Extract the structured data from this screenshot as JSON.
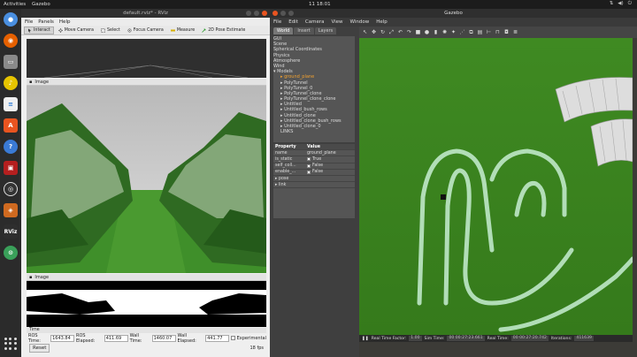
{
  "topbar": {
    "activities": "Activities",
    "app_name": "Gazebo",
    "clock": "11 18:01",
    "tray_icons": [
      "network-icon",
      "volume-icon",
      "power-icon"
    ]
  },
  "dock": {
    "icons": [
      "chromium-icon",
      "firefox-icon",
      "files-icon",
      "rhythmbox-icon",
      "writer-icon",
      "software-icon",
      "help-icon",
      "terminal-icon",
      "obs-icon",
      "rviz-cube-icon",
      "rviz-icon",
      "greenapp-icon",
      "apps-grid-icon"
    ],
    "rviz_label": "RViz"
  },
  "rviz": {
    "title": "default.rviz* - RViz",
    "menu": [
      "File",
      "Panels",
      "Help"
    ],
    "tools": [
      "Interact",
      "Move Camera",
      "Select",
      "Focus Camera",
      "Measure",
      "2D Pose Estimate"
    ],
    "image_panel_1": "Image",
    "image_panel_2": "Image",
    "time_panel": "Time",
    "time": {
      "ros_time_label": "ROS Time:",
      "ros_time": "1643.84",
      "ros_elapsed_label": "ROS Elapsed:",
      "ros_elapsed": "411.69",
      "wall_time_label": "Wall Time:",
      "wall_time": "1460.07",
      "wall_elapsed_label": "Wall Elapsed:",
      "wall_elapsed": "441.77",
      "experimental_label": "Experimental"
    },
    "reset_label": "Reset",
    "fps": "18 fps"
  },
  "gazebo": {
    "title": "Gazebo",
    "menu": [
      "File",
      "Edit",
      "Camera",
      "View",
      "Window",
      "Help"
    ],
    "tabs": [
      "World",
      "Insert",
      "Layers"
    ],
    "tree": [
      {
        "label": "GUI",
        "child": false,
        "sel": false
      },
      {
        "label": "Scene",
        "child": false,
        "sel": false
      },
      {
        "label": "Spherical Coordinates",
        "child": false,
        "sel": false
      },
      {
        "label": "Physics",
        "child": false,
        "sel": false
      },
      {
        "label": "Atmosphere",
        "child": false,
        "sel": false
      },
      {
        "label": "Wind",
        "child": false,
        "sel": false
      },
      {
        "label": "▾ Models",
        "child": false,
        "sel": false
      },
      {
        "label": "▸ ground_plane",
        "child": true,
        "sel": true
      },
      {
        "label": "▸ PolyTunnel",
        "child": true,
        "sel": false
      },
      {
        "label": "▸ PolyTunnel_0",
        "child": true,
        "sel": false
      },
      {
        "label": "▸ PolyTunnel_clone",
        "child": true,
        "sel": false
      },
      {
        "label": "▸ PolyTunnel_clone_clone",
        "child": true,
        "sel": false
      },
      {
        "label": "▸ Untitled",
        "child": true,
        "sel": false
      },
      {
        "label": "▸ Untitled_bush_rows",
        "child": true,
        "sel": false
      },
      {
        "label": "▸ Untitled_clone",
        "child": true,
        "sel": false
      },
      {
        "label": "▸ Untitled_clone_bush_rows",
        "child": true,
        "sel": false
      },
      {
        "label": "▸ Untitled_clone_0",
        "child": true,
        "sel": false
      },
      {
        "label": "LINKS",
        "child": true,
        "sel": false
      }
    ],
    "props_head": {
      "k": "Property",
      "v": "Value"
    },
    "props": [
      {
        "k": "name",
        "v": "ground_plane",
        "check": false
      },
      {
        "k": "is_static",
        "v": "True",
        "check": true
      },
      {
        "k": "self_coll...",
        "v": "False",
        "check": true
      },
      {
        "k": "enable_...",
        "v": "False",
        "check": true
      },
      {
        "k": "▸ pose",
        "v": "",
        "check": false
      },
      {
        "k": "▸ link",
        "v": "",
        "check": false
      }
    ],
    "scene_tools": [
      "pointer-icon",
      "move-icon",
      "rotate-icon",
      "scale-icon",
      "undo-icon",
      "redo-icon",
      "box-icon",
      "sphere-icon",
      "cylinder-icon",
      "pointlight-icon",
      "spotlight-icon",
      "dirlight-icon",
      "copy-icon",
      "paste-icon",
      "align-icon",
      "snap-icon",
      "screenshot-icon",
      "log-icon"
    ],
    "status": {
      "real_time_factor_label": "Real Time Factor:",
      "real_time_factor": "1.00",
      "sim_time_label": "Sim Time:",
      "sim_time": "00 00:27:23.661",
      "real_time_label": "Real Time:",
      "real_time": "00 00:27:20.742",
      "iterations_label": "Iterations:",
      "iterations": "411639"
    }
  }
}
